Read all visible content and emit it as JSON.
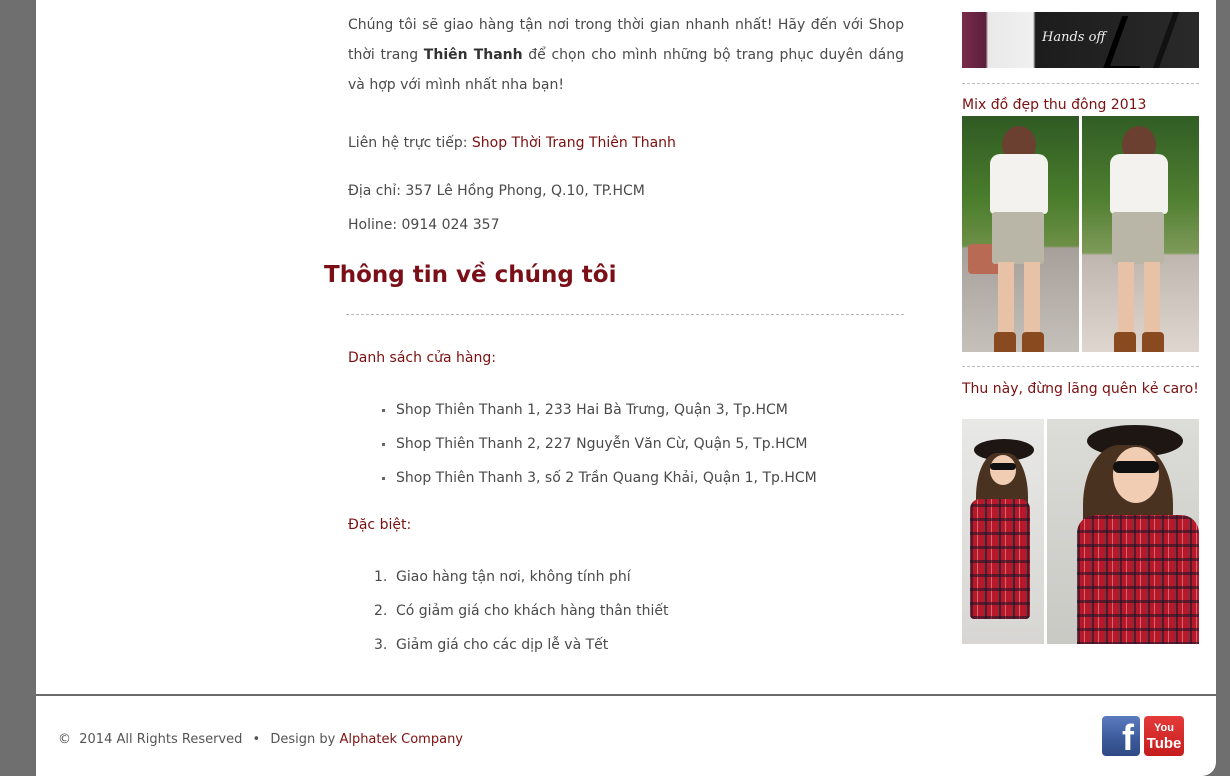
{
  "content": {
    "intro_part1": "Chúng tôi sẽ giao hàng tận nơi trong thời gian nhanh nhất! Hãy đến với Shop thời trang ",
    "intro_brand": "Thiên Thanh",
    "intro_part2": " để chọn cho mình những bộ trang phục duyên dáng và hợp với mình nhất nha bạn!",
    "contact_label": "Liên hệ trực tiếp: ",
    "contact_link": "Shop Thời Trang Thiên Thanh",
    "address": "Địa chỉ: 357 Lê Hồng Phong, Q.10, TP.HCM",
    "hotline": "Holine: 0914 024 357"
  },
  "about": {
    "title": "Thông tin về chúng tôi",
    "stores_title": "Danh sách cửa hàng:",
    "stores": [
      "Shop Thiên Thanh 1, 233 Hai Bà Trưng, Quận 3, Tp.HCM",
      "Shop Thiên Thanh 2, 227 Nguyễn Văn Cừ, Quận 5, Tp.HCM",
      "Shop Thiên Thanh 3, số 2 Trần Quang Khải, Quận 1, Tp.HCM"
    ],
    "special_title": "Đặc biệt:",
    "special": [
      {
        "num": "1.",
        "text": "Giao hàng tận nơi, không tính phí"
      },
      {
        "num": "2.",
        "text": "Có giảm giá cho khách hàng thân thiết"
      },
      {
        "num": "3.",
        "text": "Giảm giá cho các dịp lễ và Tết"
      }
    ]
  },
  "sidebar": {
    "top_image_caption": "Hands off",
    "posts": [
      {
        "title": "Mix đồ đẹp thu đông 2013"
      },
      {
        "title": "Thu này, đừng lãng quên kẻ caro!"
      }
    ]
  },
  "footer": {
    "copyright_symbol": "©",
    "copyright": "2014 All Rights Reserved",
    "bullet": "•",
    "design_by": "Design by ",
    "company": "Alphatek Company",
    "facebook_glyph": "f",
    "youtube_you": "You",
    "youtube_tube": "Tube"
  },
  "icons": [
    "facebook-icon",
    "youtube-icon"
  ],
  "colors": {
    "accent": "#7a1010",
    "heading": "#7a0f17",
    "facebook": "#3b5998",
    "youtube": "#c51d1d",
    "frame": "#6f6f6f"
  }
}
